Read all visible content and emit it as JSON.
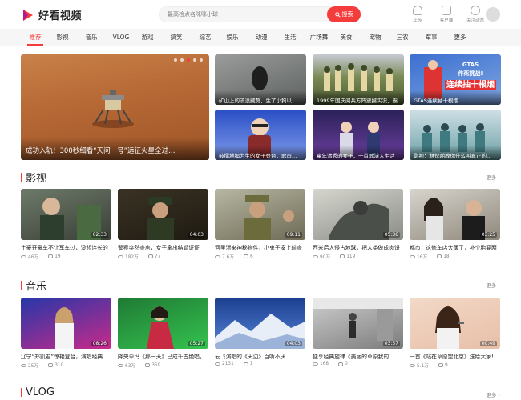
{
  "header": {
    "logo_text": "好看视频",
    "search_placeholder": "最高检点名咪咪小球",
    "search_button": "搜索",
    "icons": [
      {
        "name": "upload-icon",
        "label": "上传"
      },
      {
        "name": "client-icon",
        "label": "客户端"
      },
      {
        "name": "follow-icon",
        "label": "关注动态"
      }
    ]
  },
  "nav": {
    "items": [
      "推荐",
      "影视",
      "音乐",
      "VLOG",
      "游戏",
      "搞笑",
      "综艺",
      "娱乐",
      "动漫",
      "生活",
      "广场舞",
      "美食",
      "宠物",
      "三农",
      "军事",
      "更多"
    ],
    "active_index": 0
  },
  "banner": {
    "hero_caption": "成功入轨！300秒细看“天问一号”远征火星全过…",
    "small": [
      "矿山上的流浪藏獒，生了小狗以…",
      "1999年国庆阅兵方阵震撼实况，霸…",
      "GTAS连续袖十根烟",
      "鼓擂地揭为生的女子登台，歌声…",
      "童年清秀的女子，一首歌演入生活",
      "影视：林伙啪教你什么叫真正的…"
    ],
    "gtas_line1": "GTAS",
    "gtas_line2": "作死挑战!",
    "gtas_big": "连续抽十根烟"
  },
  "sections": [
    {
      "title": "影视",
      "more": "更多 ›",
      "cards": [
        {
          "title": "土豪开豪车不让军车过，没想连长的",
          "duration": "02:33",
          "views": "46万",
          "comments": "19"
        },
        {
          "title": "警察突然查房，女子拿出结婚证证",
          "duration": "04:03",
          "views": "182万",
          "comments": "77"
        },
        {
          "title": "河里漂来神秘物件，小鬼子凑上前查",
          "duration": "09:11",
          "views": "7.6万",
          "comments": "6"
        },
        {
          "title": "西米后人侵占地球，把人类做成肉饼",
          "duration": "05:36",
          "views": "90万",
          "comments": "119"
        },
        {
          "title": "都市：这修车店太薄了，补个胎要两",
          "duration": "03:25",
          "views": "16万",
          "comments": "18"
        }
      ]
    },
    {
      "title": "音乐",
      "more": "更多 ›",
      "cards": [
        {
          "title": "辽宁“郑凯君”惊艳登台，演唱经典",
          "duration": "08:26",
          "views": "25万",
          "comments": "310"
        },
        {
          "title": "降央卓玛《那一天》已成千古绝唱，",
          "duration": "05:27",
          "views": "63万",
          "comments": "359"
        },
        {
          "title": "云飞演唱的《天边》百听不厌",
          "duration": "04:03",
          "views": "2131",
          "comments": "1"
        },
        {
          "title": "独享经典旋律《美丽的草原我的",
          "duration": "03:57",
          "views": "168",
          "comments": "0"
        },
        {
          "title": "一首《站在草原望北京》送给大家!",
          "duration": "00:49",
          "views": "5.1万",
          "comments": "9"
        }
      ]
    },
    {
      "title": "VLOG",
      "more": "更多 ›",
      "cards": []
    }
  ]
}
